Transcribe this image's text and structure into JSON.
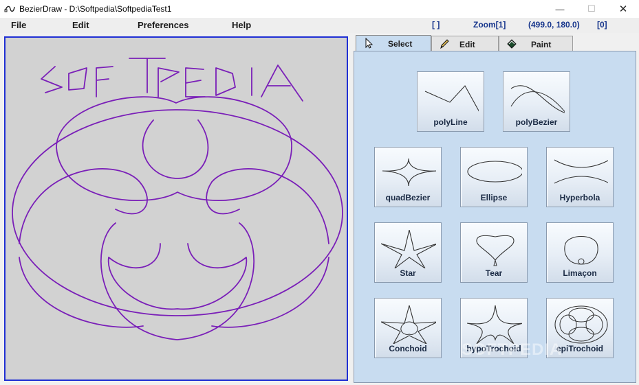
{
  "window": {
    "title": "BezierDraw - D:\\Softpedia\\SoftpediaTest1",
    "minimize_glyph": "—",
    "maximize_glyph": "☐",
    "close_glyph": "✕"
  },
  "menu": {
    "items": [
      "File",
      "Edit",
      "Preferences",
      "Help"
    ]
  },
  "status": {
    "selection": "[ ]",
    "zoom": "Zoom[1]",
    "coords": "(499.0, 180.0)",
    "index": "[0]"
  },
  "colors": {
    "stroke": "#7a1fb8",
    "canvas_border": "#1f2fd4",
    "canvas_bg": "#d2d2d2",
    "panel_bg": "#c8dcf0",
    "status_text": "#16358c"
  },
  "tabs": [
    {
      "label": "Select",
      "icon": "pointer-icon",
      "active": true
    },
    {
      "label": "Edit",
      "icon": "pencil-icon",
      "active": false
    },
    {
      "label": "Paint",
      "icon": "paint-bucket-icon",
      "active": false
    }
  ],
  "shapes": [
    {
      "id": "polyline",
      "label": "polyLine"
    },
    {
      "id": "polybezier",
      "label": "polyBezier"
    },
    {
      "id": "quadbezier",
      "label": "quadBezier"
    },
    {
      "id": "ellipse",
      "label": "Ellipse"
    },
    {
      "id": "hyperbola",
      "label": "Hyperbola"
    },
    {
      "id": "star",
      "label": "Star"
    },
    {
      "id": "tear",
      "label": "Tear"
    },
    {
      "id": "limacon",
      "label": "Limaçon"
    },
    {
      "id": "conchoid",
      "label": "Conchoid"
    },
    {
      "id": "hypotrochoid",
      "label": "hypoTrochoid"
    },
    {
      "id": "epitrochoid",
      "label": "epiTrochoid"
    }
  ],
  "watermark": "SOFTPEDIA"
}
